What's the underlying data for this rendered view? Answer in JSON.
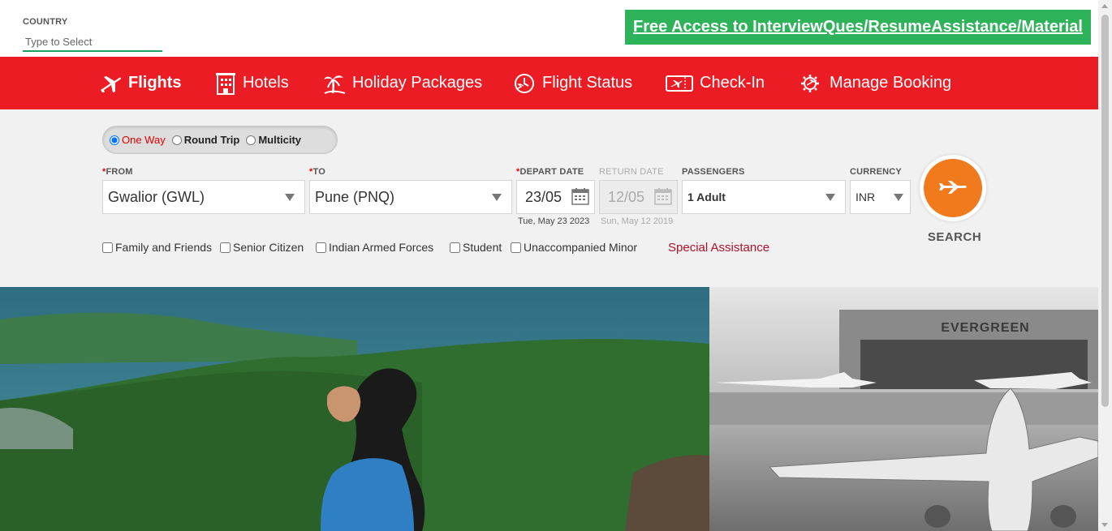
{
  "country": {
    "label": "COUNTRY",
    "placeholder": "Type to Select"
  },
  "promo": {
    "text": "Free Access to InterviewQues/ResumeAssistance/Material"
  },
  "nav": {
    "flights": "Flights",
    "hotels": "Hotels",
    "holiday": "Holiday Packages",
    "status": "Flight Status",
    "checkin": "Check-In",
    "manage": "Manage Booking"
  },
  "trip_type": {
    "one_way": "One Way",
    "round_trip": "Round Trip",
    "multicity": "Multicity",
    "selected": "One Way"
  },
  "form": {
    "from_label": "FROM",
    "from_value": "Gwalior (GWL)",
    "to_label": "TO",
    "to_value": "Pune (PNQ)",
    "depart_label": "DEPART DATE",
    "depart_value": "23/05",
    "depart_full": "Tue, May 23 2023",
    "return_label": "RETURN DATE",
    "return_value": "12/05",
    "return_full": "Sun, May 12 2019",
    "passengers_label": "PASSENGERS",
    "passengers_value": "1 Adult",
    "currency_label": "CURRENCY",
    "currency_value": "INR",
    "required_mark": "*"
  },
  "search": {
    "label": "SEARCH"
  },
  "options": {
    "family": "Family and Friends",
    "senior": "Senior Citizen",
    "armed": "Indian Armed Forces",
    "student": "Student",
    "minor": "Unaccompanied Minor",
    "special": "Special Assistance"
  },
  "hero": {
    "hangar_sign": "EVERGREEN"
  },
  "colors": {
    "brand_red": "#ec1c24",
    "promo_green": "#2eb35b",
    "search_orange": "#f07a1c"
  }
}
